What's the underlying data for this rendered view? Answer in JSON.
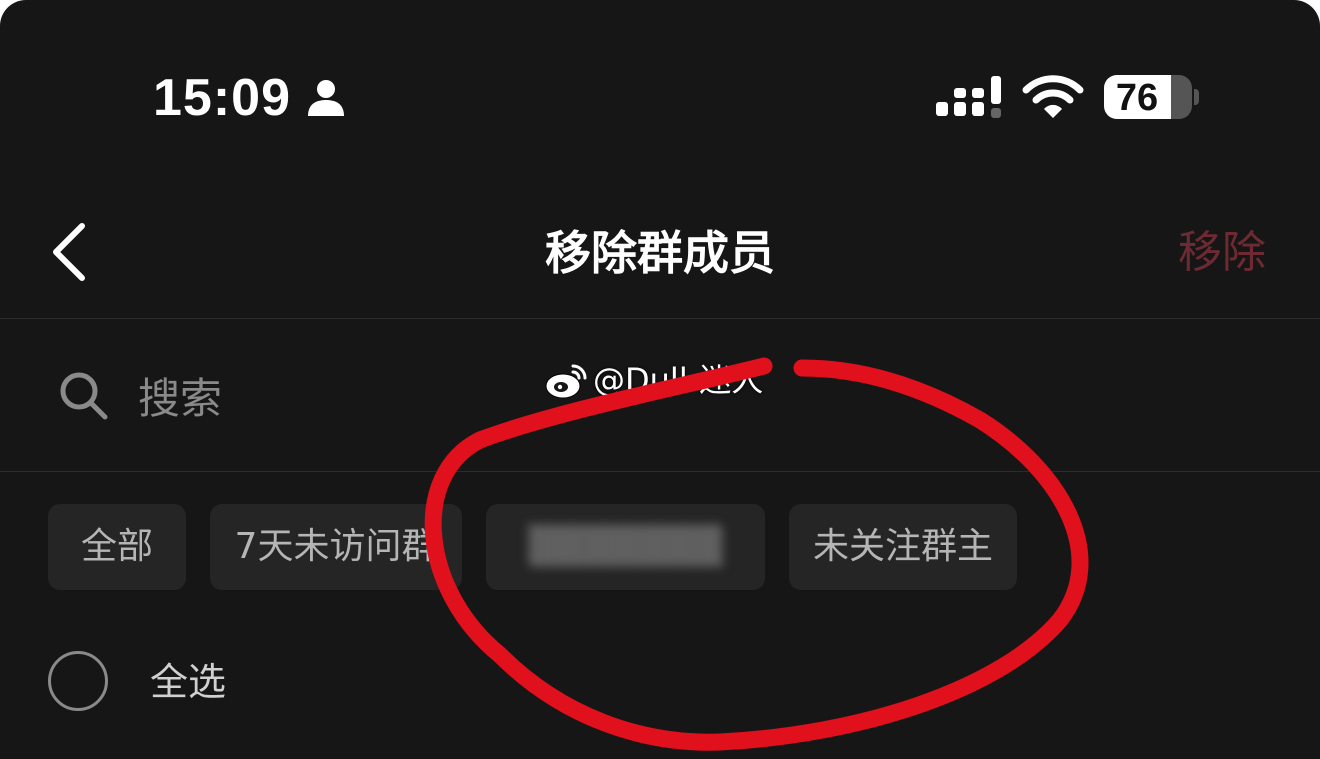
{
  "status_bar": {
    "time": "15:09",
    "battery_level": "76",
    "battery_fraction": 0.76
  },
  "nav": {
    "title": "移除群成员",
    "action_label": "移除",
    "action_color": "#6e2a33"
  },
  "search": {
    "placeholder": "搜索"
  },
  "filters": [
    {
      "label": "全部"
    },
    {
      "label": "7天未访问群"
    },
    {
      "label": "未关注群主"
    }
  ],
  "select_all": {
    "label": "全选"
  },
  "watermark": {
    "text": "@Dull-迷人"
  },
  "colors": {
    "background": "#161616",
    "annotation": "#e0101c"
  },
  "icons": [
    "person-icon",
    "signal-icon",
    "wifi-icon",
    "battery-icon",
    "chevron-left-icon",
    "search-icon",
    "weibo-logo-icon"
  ]
}
